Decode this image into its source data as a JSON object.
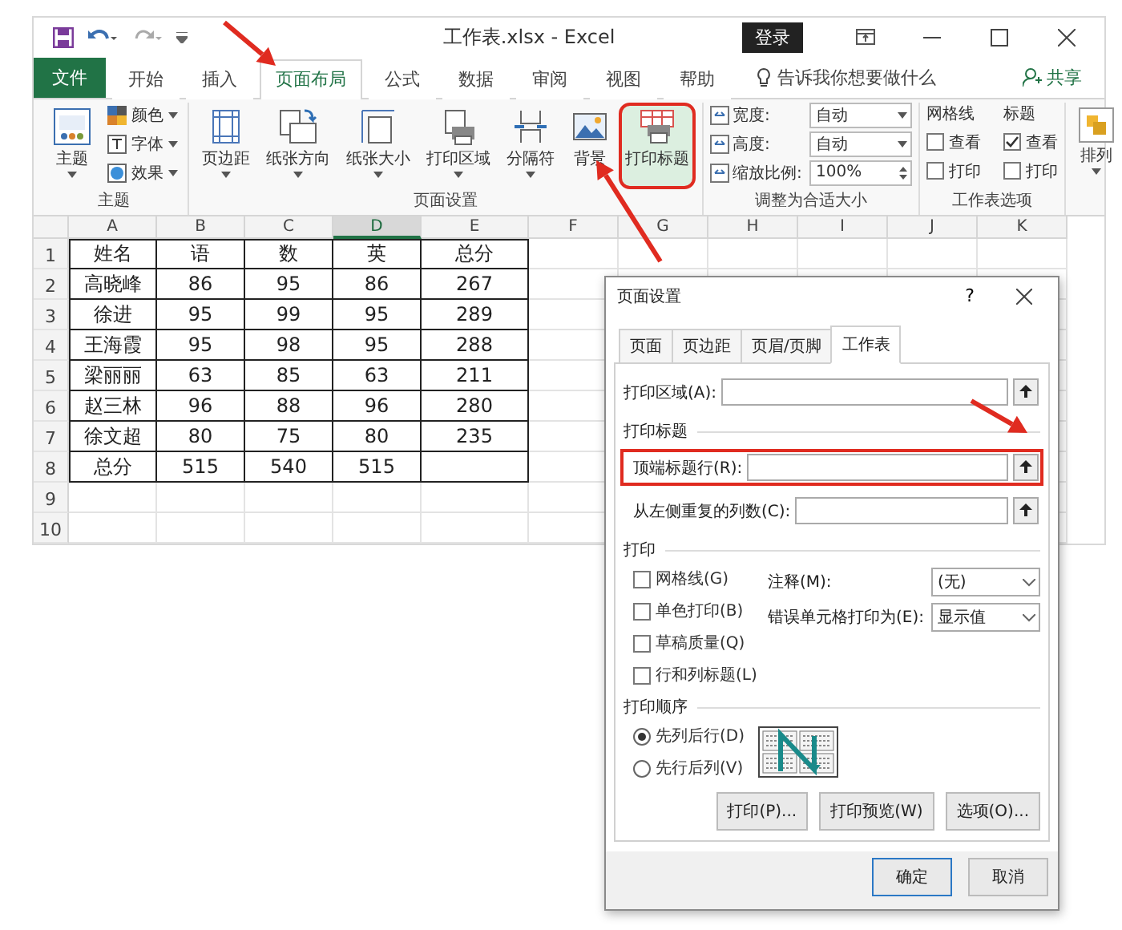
{
  "window": {
    "title": "工作表.xlsx  -  Excel",
    "login": "登录"
  },
  "file_tab": "文件",
  "menu_tabs": [
    {
      "label": "开始",
      "selected": false
    },
    {
      "label": "插入",
      "selected": false
    },
    {
      "label": "页面布局",
      "selected": true
    },
    {
      "label": "公式",
      "selected": false
    },
    {
      "label": "数据",
      "selected": false
    },
    {
      "label": "审阅",
      "selected": false
    },
    {
      "label": "视图",
      "selected": false
    },
    {
      "label": "帮助",
      "selected": false
    }
  ],
  "tell_me": "告诉我你想要做什么",
  "share": "共享",
  "ribbon": {
    "themes": {
      "label": "主题",
      "button": "主题",
      "options": [
        "颜色",
        "字体",
        "效果"
      ]
    },
    "page_setup": {
      "label": "页面设置",
      "buttons": [
        {
          "label": "页边距",
          "dropdown": true,
          "highlighted": false
        },
        {
          "label": "纸张方向",
          "dropdown": true,
          "highlighted": false
        },
        {
          "label": "纸张大小",
          "dropdown": true,
          "highlighted": false
        },
        {
          "label": "打印区域",
          "dropdown": true,
          "highlighted": false
        },
        {
          "label": "分隔符",
          "dropdown": true,
          "highlighted": false
        },
        {
          "label": "背景",
          "dropdown": false,
          "highlighted": false
        },
        {
          "label": "打印标题",
          "dropdown": false,
          "highlighted": true
        }
      ]
    },
    "scale_to_fit": {
      "label": "调整为合适大小",
      "rows": [
        {
          "kind": "dropdown",
          "label": "宽度:",
          "value": "自动"
        },
        {
          "kind": "dropdown",
          "label": "高度:",
          "value": "自动"
        },
        {
          "kind": "spinner",
          "label": "缩放比例:",
          "value": "100%"
        }
      ]
    },
    "sheet_options": {
      "label": "工作表选项",
      "columns": [
        {
          "header": "网格线",
          "items": [
            {
              "label": "查看",
              "checked": false
            },
            {
              "label": "打印",
              "checked": false
            }
          ]
        },
        {
          "header": "标题",
          "items": [
            {
              "label": "查看",
              "checked": true
            },
            {
              "label": "打印",
              "checked": false
            }
          ]
        }
      ]
    },
    "arrange": {
      "button": "排列"
    }
  },
  "sheet": {
    "columns": [
      {
        "label": "A",
        "selected": false
      },
      {
        "label": "B",
        "selected": false
      },
      {
        "label": "C",
        "selected": false
      },
      {
        "label": "D",
        "selected": true
      },
      {
        "label": "E",
        "selected": false
      },
      {
        "label": "F",
        "selected": false
      },
      {
        "label": "G",
        "selected": false
      },
      {
        "label": "H",
        "selected": false
      },
      {
        "label": "I",
        "selected": false
      },
      {
        "label": "J",
        "selected": false
      },
      {
        "label": "K",
        "selected": false
      }
    ],
    "rows": [
      {
        "number": "1",
        "cells": [
          "姓名",
          "语",
          "数",
          "英",
          "总分"
        ]
      },
      {
        "number": "2",
        "cells": [
          "高晓峰",
          "86",
          "95",
          "86",
          "267"
        ]
      },
      {
        "number": "3",
        "cells": [
          "徐进",
          "95",
          "99",
          "95",
          "289"
        ]
      },
      {
        "number": "4",
        "cells": [
          "王海霞",
          "95",
          "98",
          "95",
          "288"
        ]
      },
      {
        "number": "5",
        "cells": [
          "梁丽丽",
          "63",
          "85",
          "63",
          "211"
        ]
      },
      {
        "number": "6",
        "cells": [
          "赵三林",
          "96",
          "88",
          "96",
          "280"
        ]
      },
      {
        "number": "7",
        "cells": [
          "徐文超",
          "80",
          "75",
          "80",
          "235"
        ]
      },
      {
        "number": "8",
        "cells": [
          "总分",
          "515",
          "540",
          "515"
        ]
      },
      {
        "number": "9"
      },
      {
        "number": "10"
      }
    ]
  },
  "dialog": {
    "title": "页面设置",
    "help": "?",
    "tabs": [
      {
        "label": "页面",
        "selected": false
      },
      {
        "label": "页边距",
        "selected": false
      },
      {
        "label": "页眉/页脚",
        "selected": false
      },
      {
        "label": "工作表",
        "selected": true
      }
    ],
    "print_area": {
      "label": "打印区域(A):"
    },
    "print_titles": {
      "heading": "打印标题",
      "fields": [
        {
          "label": "顶端标题行(R):",
          "highlighted": true
        },
        {
          "label": "从左侧重复的列数(C):",
          "highlighted": false
        }
      ]
    },
    "print": {
      "heading": "打印",
      "checkboxes": [
        {
          "label": "网格线(G)",
          "checked": false
        },
        {
          "label": "单色打印(B)",
          "checked": false
        },
        {
          "label": "草稿质量(Q)",
          "checked": false
        },
        {
          "label": "行和列标题(L)",
          "checked": false
        }
      ],
      "selects": [
        {
          "label": "注释(M):",
          "value": "(无)"
        },
        {
          "label": "错误单元格打印为(E):",
          "value": "显示值"
        }
      ]
    },
    "page_order": {
      "heading": "打印顺序",
      "options": [
        {
          "label": "先列后行(D)",
          "selected": true
        },
        {
          "label": "先行后列(V)",
          "selected": false
        }
      ]
    },
    "action_buttons": [
      "打印(P)...",
      "打印预览(W)",
      "选项(O)..."
    ],
    "ok": "确定",
    "cancel": "取消"
  }
}
